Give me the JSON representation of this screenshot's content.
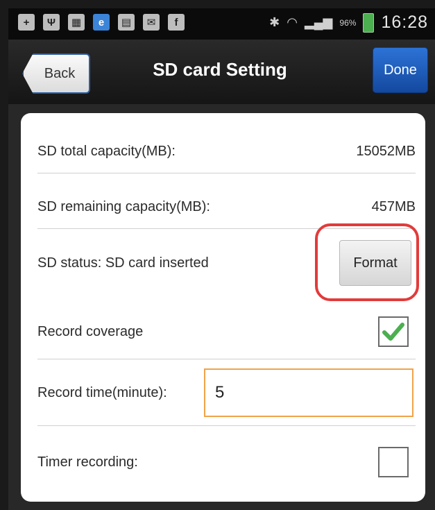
{
  "status_bar": {
    "icons": [
      "plus-icon",
      "usb-icon",
      "gallery-icon",
      "browser-icon",
      "document-icon",
      "mail-icon",
      "facebook-icon"
    ],
    "battery_percent": "96%",
    "time": "16:28"
  },
  "header": {
    "back_label": "Back",
    "title": "SD card Setting",
    "done_label": "Done"
  },
  "settings": {
    "total_capacity_label": "SD total capacity(MB):",
    "total_capacity_value": "15052MB",
    "remaining_capacity_label": "SD remaining capacity(MB):",
    "remaining_capacity_value": "457MB",
    "status_label": "SD status: SD card inserted",
    "format_label": "Format",
    "record_coverage_label": "Record coverage",
    "record_coverage_checked": true,
    "record_time_label": "Record time(minute):",
    "record_time_value": "5",
    "timer_recording_label": "Timer recording:",
    "timer_recording_checked": false
  },
  "colors": {
    "done_button": "#1f5fc2",
    "highlight": "#e23b3b",
    "input_border": "#f0a34a",
    "check": "#4caf50"
  }
}
